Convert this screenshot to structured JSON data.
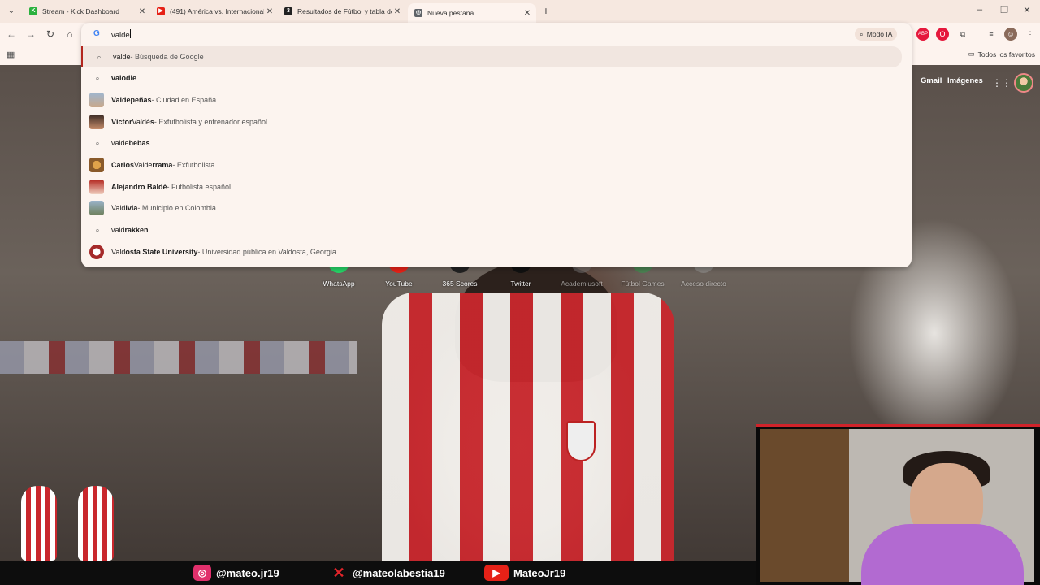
{
  "browser": {
    "tabs": [
      {
        "label": "Stream - Kick Dashboard",
        "icon": "kick-icon",
        "color": "#2ab13e",
        "glyph": "K"
      },
      {
        "label": "(491) América vs. Internacional",
        "icon": "youtube-icon",
        "color": "#e62117",
        "glyph": "▶"
      },
      {
        "label": "Resultados de Fútbol y tabla de",
        "icon": "365scores-icon",
        "color": "#222222",
        "glyph": "3"
      },
      {
        "label": "Nueva pestaña",
        "icon": "chrome-icon",
        "color": "#5f6368",
        "glyph": "◎"
      }
    ],
    "omnibox": {
      "typed": "valde",
      "modo_ia": "Modo IA"
    },
    "bookmarks": {
      "favorites_label": "Todos los favoritos"
    }
  },
  "suggestions": [
    {
      "kind": "search",
      "bold": "",
      "normal": "valde",
      "desc": " - Búsqueda de Google",
      "icon": "search-icon"
    },
    {
      "kind": "search",
      "bold_tail": "odle",
      "normal": "val",
      "desc": "",
      "icon": "search-icon",
      "full": "valodle"
    },
    {
      "kind": "entity",
      "full_bold": "Valdepeñas",
      "desc": " - Ciudad en España",
      "thumb": "#8aa0b8"
    },
    {
      "kind": "entity",
      "full_bold": "Víctor Valdés",
      "desc": " - Exfutbolista y entrenador español",
      "thumb": "#7a4a3a"
    },
    {
      "kind": "search",
      "full": "valdebebas",
      "icon": "search-icon"
    },
    {
      "kind": "entity",
      "full_bold": "Carlos Valderrama",
      "desc": " - Exfutbolista",
      "thumb": "#c08a3a"
    },
    {
      "kind": "entity",
      "full_bold": "Alejandro Baldé",
      "desc": " - Futbolista español",
      "thumb": "#b3261e"
    },
    {
      "kind": "entity",
      "full_bold": "Valdivia",
      "desc": " - Municipio en Colombia",
      "thumb": "#6d8aa0"
    },
    {
      "kind": "search",
      "full": "valdrakken",
      "icon": "search-icon"
    },
    {
      "kind": "entity",
      "full_bold": "Valdosta State University",
      "desc": " - Universidad pública en Valdosta, Georgia",
      "thumb": "#a52a2a"
    }
  ],
  "suggestion_text": {
    "s0_query": "valde",
    "s0_desc": " - Búsqueda de Google",
    "s1_plain": "val",
    "s1_bold": "odle",
    "s2_plain": "Valde",
    "s2_bold": "peñas",
    "s2_desc": " - Ciudad en España",
    "s3_bold1": "Víctor ",
    "s3_plain": "Valdé",
    "s3_bold2": "s",
    "s3_desc": " - Exfutbolista y entrenador español",
    "s4_plain": "valde",
    "s4_bold": "bebas",
    "s5_bold1": "Carlos ",
    "s5_plain": "Valde",
    "s5_bold2": "rrama",
    "s5_desc": " - Exfutbolista",
    "s6_bold": "Alejandro Baldé",
    "s6_desc": " - Futbolista español",
    "s7_plain": "Vald",
    "s7_bold": "ivia",
    "s7_desc": " - Municipio en Colombia",
    "s8_plain": "vald",
    "s8_bold": "rakken",
    "s9_plain": "Vald",
    "s9_bold": "osta State University",
    "s9_desc": " - Universidad pública en Valdosta, Georgia"
  },
  "google": {
    "gmail": "Gmail",
    "images": "Imágenes"
  },
  "shortcuts": [
    {
      "label": "WhatsApp",
      "color": "#25d366"
    },
    {
      "label": "YouTube",
      "color": "#e62117"
    },
    {
      "label": "365 Scores",
      "color": "#222222"
    },
    {
      "label": "Twitter",
      "color": "#111111"
    },
    {
      "label": "Academiusoft",
      "color": "#777777"
    },
    {
      "label": "Fútbol Games",
      "color": "#2aa24a"
    },
    {
      "label": "Acceso directo",
      "color": "#999999"
    }
  ],
  "overlay": {
    "instagram": "@mateo.jr19",
    "x": "@mateolabestia19",
    "youtube": "MateoJr19"
  }
}
